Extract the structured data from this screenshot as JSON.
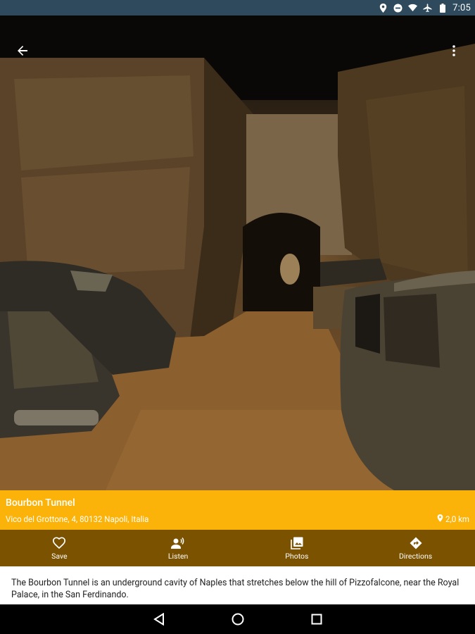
{
  "status_bar": {
    "time": "7:05",
    "icons": [
      "location-icon",
      "do-not-disturb-icon",
      "wifi-icon",
      "airplane-icon",
      "battery-icon"
    ]
  },
  "app_bar": {
    "back_icon": "arrow-back-icon",
    "menu_icon": "more-vert-icon"
  },
  "place": {
    "title": "Bourbon Tunnel",
    "address": "Vico del Grottone, 4, 80132 Napoli, Italia",
    "distance": "2,0 km"
  },
  "actions": [
    {
      "label": "Save",
      "icon": "heart-outline-icon"
    },
    {
      "label": "Listen",
      "icon": "voice-listen-icon"
    },
    {
      "label": "Photos",
      "icon": "photo-library-icon"
    },
    {
      "label": "Directions",
      "icon": "directions-icon"
    }
  ],
  "description": "The Bourbon Tunnel is an underground cavity of Naples that stretches below the hill of Pizzofalcone, near the Royal Palace, in the San Ferdinando.",
  "colors": {
    "status_bar": "#2e4a5c",
    "accent": "#fbb30a",
    "action_bar": "#7a5200",
    "description_bg": "#ffffff"
  }
}
